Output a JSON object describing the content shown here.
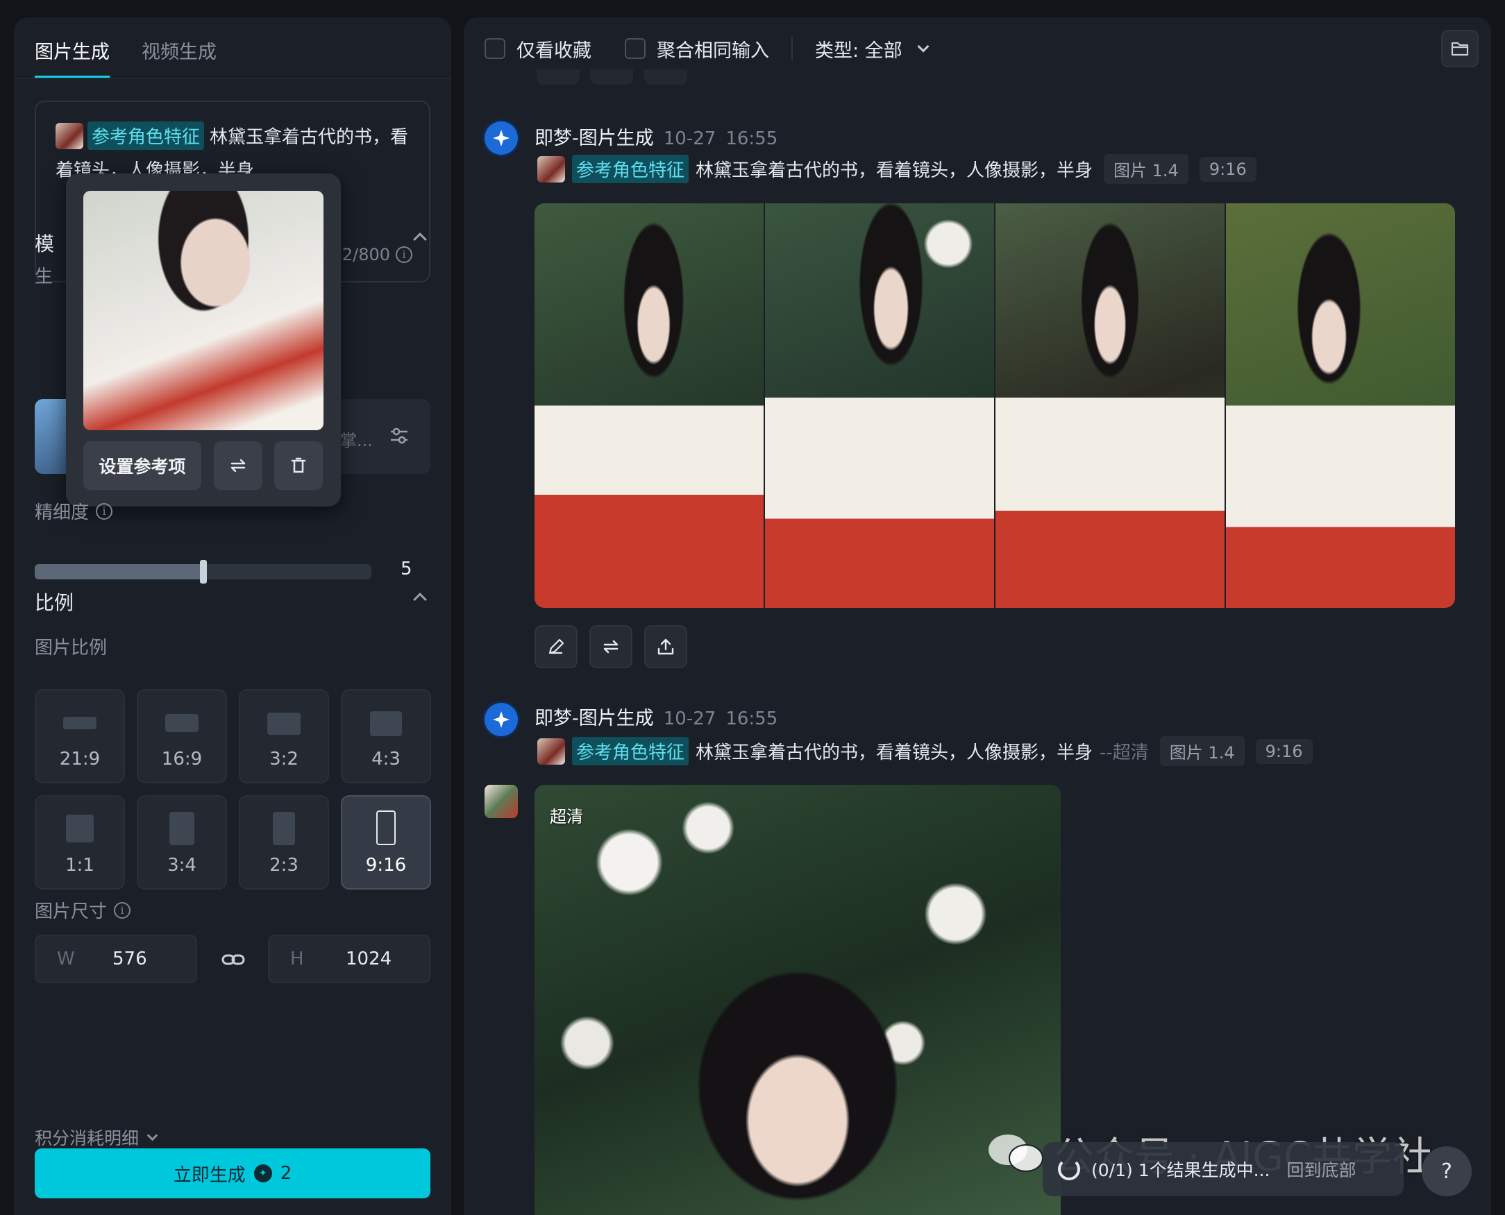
{
  "left": {
    "tabs": [
      {
        "label": "图片生成",
        "active": true
      },
      {
        "label": "视频生成",
        "active": false
      }
    ],
    "prompt": {
      "ref_tag": "参考角色特征",
      "text": "林黛玉拿着古代的书，看",
      "text_line2": "着镜头，人像摄影，半身",
      "counter": "22/800"
    },
    "model_section": {
      "title": "模",
      "sub": "生",
      "model_name": "掌..."
    },
    "popover": {
      "set_ref_label": "设置参考项"
    },
    "detail": {
      "label": "精细度",
      "value": "5",
      "fraction": 0.5
    },
    "ratio": {
      "title": "比例",
      "sub": "图片比例",
      "options": [
        {
          "label": "21:9",
          "selected": false
        },
        {
          "label": "16:9",
          "selected": false
        },
        {
          "label": "3:2",
          "selected": false
        },
        {
          "label": "4:3",
          "selected": false
        },
        {
          "label": "1:1",
          "selected": false
        },
        {
          "label": "3:4",
          "selected": false
        },
        {
          "label": "2:3",
          "selected": false
        },
        {
          "label": "9:16",
          "selected": true
        }
      ]
    },
    "size": {
      "label": "图片尺寸",
      "w_letter": "W",
      "w": "576",
      "h_letter": "H",
      "h": "1024"
    },
    "cost_label": "积分消耗明细",
    "generate": {
      "label": "立即生成",
      "cost": "2"
    }
  },
  "right": {
    "filters": {
      "fav_only": "仅看收藏",
      "merge_same": "聚合相同输入",
      "type": "类型: 全部"
    },
    "messages": [
      {
        "title": "即梦-图片生成",
        "date": "10-27",
        "time": "16:55",
        "ref_tag": "参考角色特征",
        "prompt": "林黛玉拿着古代的书，看着镜头，人像摄影，半身",
        "suffix": "",
        "model": "图片 1.4",
        "ratio": "9:16"
      },
      {
        "title": "即梦-图片生成",
        "date": "10-27",
        "time": "16:55",
        "ref_tag": "参考角色特征",
        "prompt": "林黛玉拿着古代的书，看着镜头，人像摄影，半身",
        "suffix": "--超清",
        "model": "图片 1.4",
        "ratio": "9:16"
      }
    ],
    "hd_badge": "超清",
    "status": {
      "text": "(0/1) 1个结果生成中...",
      "link": "回到底部"
    },
    "help": "?",
    "watermark": "公众号 · AIGC共学社"
  },
  "colors": {
    "accent": "#00c8dc",
    "bg": "#111419",
    "panel": "#1b1f27"
  }
}
